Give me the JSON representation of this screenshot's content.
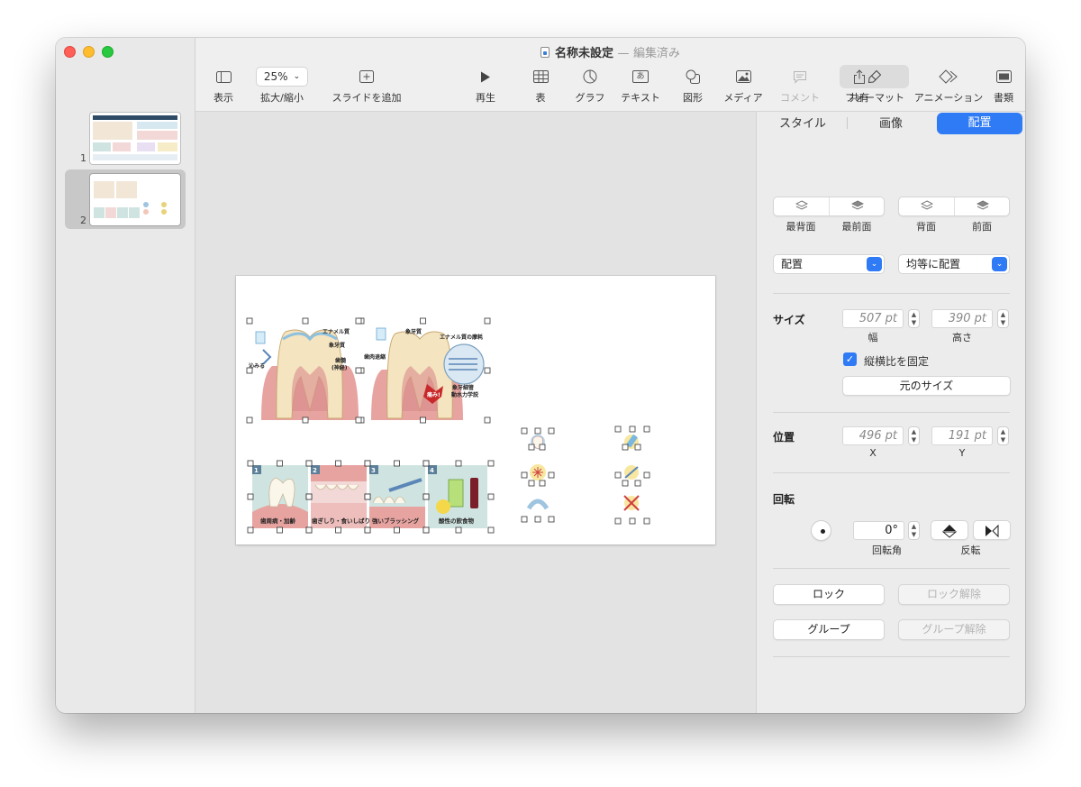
{
  "window": {
    "title": "名称未設定",
    "title_separator": "—",
    "title_status": "編集済み"
  },
  "navigator": {
    "slides": [
      {
        "number": "1",
        "selected": false
      },
      {
        "number": "2",
        "selected": true
      }
    ]
  },
  "toolbar": {
    "view": {
      "label": "表示",
      "icon": "sidebar-icon"
    },
    "zoom": {
      "label": "拡大/縮小",
      "value": "25%",
      "icon": "chevron-down-icon"
    },
    "add_slide": {
      "label": "スライドを追加",
      "icon": "plus-square-icon"
    },
    "play": {
      "label": "再生",
      "icon": "play-icon"
    },
    "table": {
      "label": "表",
      "icon": "table-icon"
    },
    "chart": {
      "label": "グラフ",
      "icon": "chart-icon"
    },
    "text": {
      "label": "テキスト",
      "icon": "text-box-icon",
      "glyph": "あ"
    },
    "shape": {
      "label": "図形",
      "icon": "shape-icon"
    },
    "media": {
      "label": "メディア",
      "icon": "image-icon"
    },
    "comment": {
      "label": "コメント",
      "icon": "comment-icon",
      "disabled": true
    },
    "share": {
      "label": "共有",
      "icon": "share-icon"
    },
    "format": {
      "label": "フォーマット",
      "icon": "paintbrush-icon",
      "active": true
    },
    "animate": {
      "label": "アニメーション",
      "icon": "diamond-icon"
    },
    "document": {
      "label": "書類",
      "icon": "document-panel-icon"
    }
  },
  "slide_content": {
    "diagram1_labels": [
      "エナメル質",
      "象牙質",
      "歯髄",
      "(神経)",
      "沁みる"
    ],
    "diagram2_labels": [
      "象牙質",
      "エナメル質の摩耗",
      "歯肉退縮",
      "象牙細管",
      "動水力学説",
      "痛み!"
    ],
    "panels": [
      {
        "number": "1",
        "caption": "歯周病・加齢"
      },
      {
        "number": "2",
        "caption": "歯ぎしり・食いしばり"
      },
      {
        "number": "3",
        "caption": "強いブラッシング"
      },
      {
        "number": "4",
        "caption": "酸性の飲食物"
      }
    ]
  },
  "inspector": {
    "tabs": [
      {
        "label": "スタイル",
        "active": false
      },
      {
        "label": "画像",
        "active": false
      },
      {
        "label": "配置",
        "active": true
      }
    ],
    "layer_buttons": [
      "最背面",
      "最前面",
      "背面",
      "前面"
    ],
    "align_select": "配置",
    "distribute_select": "均等に配置",
    "size": {
      "label": "サイズ",
      "width": "507 pt",
      "height": "390 pt",
      "width_label": "幅",
      "height_label": "高さ",
      "constrain_label": "縦横比を固定",
      "constrain_checked": true,
      "original_size_button": "元のサイズ"
    },
    "position": {
      "label": "位置",
      "x": "496 pt",
      "y": "191 pt",
      "x_label": "X",
      "y_label": "Y"
    },
    "rotate": {
      "label": "回転",
      "angle": "0°",
      "angle_label": "回転角",
      "flip_label": "反転"
    },
    "lock_button": "ロック",
    "unlock_button": "ロック解除",
    "group_button": "グループ",
    "ungroup_button": "グループ解除"
  },
  "colors": {
    "accent": "#2f7af5",
    "gum": "#e7a3a0",
    "panel_bg": "#cfe4e0",
    "panel_number": "#5b7f99"
  }
}
